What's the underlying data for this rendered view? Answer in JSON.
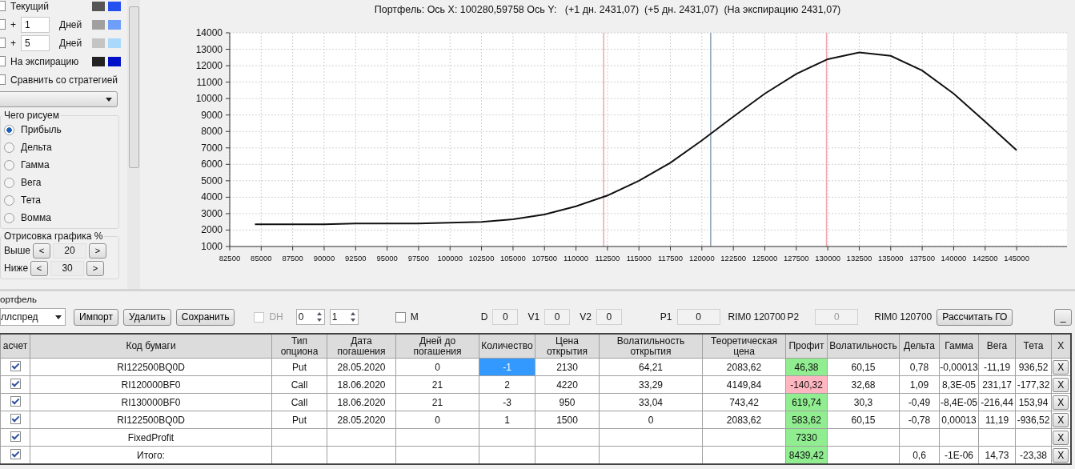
{
  "sidebar": {
    "series_rows": [
      {
        "kind": "label",
        "checked": false,
        "label": "Текущий",
        "swatches": [
          {
            "color": "#555555"
          },
          {
            "color": "#2550f0"
          }
        ]
      },
      {
        "kind": "offset",
        "checked": false,
        "sign": "+",
        "value": "1",
        "unit": "Дней",
        "swatches": [
          {
            "color": "#a0a0a0"
          },
          {
            "color": "#6e9ef8"
          }
        ]
      },
      {
        "kind": "offset",
        "checked": false,
        "sign": "+",
        "value": "5",
        "unit": "Дней",
        "swatches": [
          {
            "color": "#c4c4c4"
          },
          {
            "color": "#aad8fb"
          }
        ]
      },
      {
        "kind": "label",
        "checked": false,
        "label": "На экспирацию",
        "swatches": [
          {
            "color": "#222222"
          },
          {
            "color": "#0010c8"
          }
        ]
      }
    ],
    "compare": {
      "checked": false,
      "label": "Сравнить со стратегией"
    },
    "draw_group": {
      "title": "Чего рисуем",
      "options": [
        {
          "label": "Прибыль",
          "selected": true
        },
        {
          "label": "Дельта",
          "selected": false
        },
        {
          "label": "Гамма",
          "selected": false
        },
        {
          "label": "Вега",
          "selected": false
        },
        {
          "label": "Тета",
          "selected": false
        },
        {
          "label": "Вомма",
          "selected": false
        }
      ]
    },
    "range_group": {
      "title": "Отрисовка графика %",
      "rows": [
        {
          "label": "Выше",
          "dec": "<",
          "value": "20",
          "inc": ">"
        },
        {
          "label": "Ниже",
          "dec": "<",
          "value": "30",
          "inc": ">"
        }
      ]
    }
  },
  "chart": {
    "title": "Портфель: Ось X: 100280,59758 Ось Y:   (+1 дн. 2431,07)  (+5 дн. 2431,07)  (На экспирацию 2431,07)",
    "chart_data": {
      "type": "line",
      "grid": true,
      "xlim": [
        82500,
        149000
      ],
      "ylim": [
        1000,
        14000
      ],
      "xticks": [
        82500,
        85000,
        87500,
        90000,
        92500,
        95000,
        97500,
        100000,
        102500,
        105000,
        107500,
        110000,
        112500,
        115000,
        117500,
        120000,
        122500,
        125000,
        127500,
        130000,
        132500,
        135000,
        137500,
        140000,
        142500,
        145000
      ],
      "yticks": [
        1000,
        2000,
        3000,
        4000,
        5000,
        6000,
        7000,
        8000,
        9000,
        10000,
        11000,
        12000,
        13000,
        14000
      ],
      "x": [
        84500,
        87500,
        90000,
        92500,
        95000,
        97500,
        100000,
        102500,
        105000,
        107500,
        110000,
        112500,
        115000,
        117500,
        120000,
        122500,
        125000,
        127500,
        130000,
        132500,
        135000,
        137500,
        140000,
        142500,
        145000
      ],
      "series": [
        {
          "color": "#111111",
          "values": [
            2350,
            2350,
            2350,
            2400,
            2400,
            2400,
            2450,
            2500,
            2650,
            2950,
            3450,
            4100,
            5000,
            6100,
            7450,
            8900,
            10300,
            11500,
            12400,
            12800,
            12600,
            11700,
            10300,
            8600,
            6850
          ]
        }
      ],
      "ref_lines": [
        {
          "axis": "x",
          "value": 112200,
          "color": "#f2a6ae"
        },
        {
          "axis": "x",
          "value": 120700,
          "color": "#8aa0b4"
        },
        {
          "axis": "x",
          "value": 129900,
          "color": "#f2a6ae"
        }
      ]
    }
  },
  "portfolio": {
    "title": "ортфель",
    "toolbar": {
      "strategy": "ллспред",
      "buttons": [
        "Импорт",
        "Удалить",
        "Сохранить"
      ],
      "dh": {
        "label": "DH",
        "checked": false,
        "disabled": true
      },
      "spinners": [
        "0",
        "1"
      ],
      "m": {
        "label": "M",
        "checked": false
      },
      "fields": [
        {
          "label": "D",
          "value": "0",
          "disabled": false
        },
        {
          "label": "V1",
          "value": "0",
          "disabled": false
        },
        {
          "label": "V2",
          "value": "0",
          "disabled": false
        }
      ],
      "p1": {
        "label": "P1",
        "value": "0",
        "disabled": false,
        "note": "RIM0 120700"
      },
      "p2": {
        "label": "P2",
        "value": "0",
        "disabled": true,
        "note": "RIM0 120700"
      },
      "calc_button": "Рассчитать ГО",
      "minimize_button": "_"
    },
    "table": {
      "columns": [
        "асчет",
        "Код бумаги",
        "Тип опциона",
        "Дата погашения",
        "Дней до погашения",
        "Количество",
        "Цена открытия",
        "Волатильность открытия",
        "Теоретическая цена",
        "Профит",
        "Волатильность",
        "Дельта",
        "Гамма",
        "Вега",
        "Тета",
        "X"
      ],
      "rows": [
        {
          "checked": true,
          "selected": true,
          "color": "#90ee90",
          "cells": [
            null,
            "RI122500BQ0D",
            "Put",
            "28.05.2020",
            "0",
            "-1",
            "2130",
            "64,21",
            "2083,62",
            "46,38",
            "60,15",
            "0,78",
            "-0,00013",
            "-11,19",
            "936,52",
            "X"
          ]
        },
        {
          "checked": true,
          "selected": false,
          "color": "#ffb6c1",
          "cells": [
            null,
            "RI120000BF0",
            "Call",
            "18.06.2020",
            "21",
            "2",
            "4220",
            "33,29",
            "4149,84",
            "-140,32",
            "32,68",
            "1,09",
            "8,3E-05",
            "231,17",
            "-177,32",
            "X"
          ]
        },
        {
          "checked": true,
          "selected": false,
          "color": "#90ee90",
          "cells": [
            null,
            "RI130000BF0",
            "Call",
            "18.06.2020",
            "21",
            "-3",
            "950",
            "33,04",
            "743,42",
            "619,74",
            "30,3",
            "-0,49",
            "-8,4E-05",
            "-216,44",
            "153,94",
            "X"
          ]
        },
        {
          "checked": true,
          "selected": false,
          "color": "#90ee90",
          "cells": [
            null,
            "RI122500BQ0D",
            "Put",
            "28.05.2020",
            "0",
            "1",
            "1500",
            "0",
            "2083,62",
            "583,62",
            "60,15",
            "-0,78",
            "0,00013",
            "11,19",
            "-936,52",
            "X"
          ]
        },
        {
          "checked": true,
          "selected": false,
          "color": "#90ee90",
          "cells": [
            null,
            "FixedProfit",
            null,
            null,
            null,
            null,
            null,
            null,
            null,
            "7330",
            null,
            null,
            null,
            null,
            null,
            "X"
          ]
        },
        {
          "checked": true,
          "selected": false,
          "color": "#90ee90",
          "cells": [
            null,
            "Итого:",
            null,
            null,
            null,
            null,
            null,
            null,
            null,
            "8439,42",
            null,
            "0,6",
            "-1E-06",
            "14,73",
            "-23,38",
            "X"
          ]
        }
      ]
    }
  }
}
